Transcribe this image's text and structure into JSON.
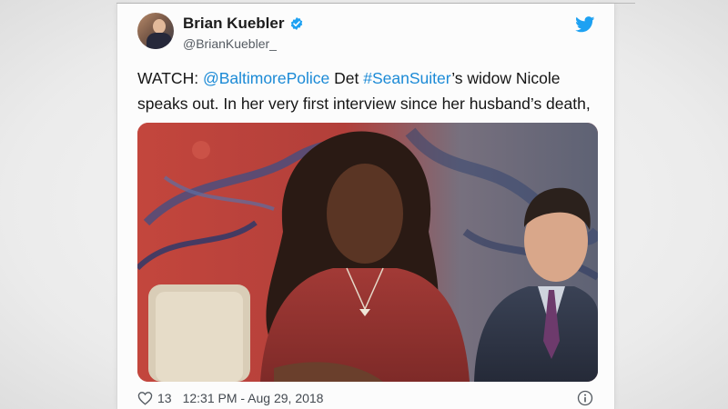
{
  "tweet": {
    "display_name": "Brian Kuebler",
    "handle": "@BrianKuebler_",
    "text": {
      "prefix": "WATCH: ",
      "mention": "@BaltimorePolice",
      "middle": " Det ",
      "hashtag": "#SeanSuiter",
      "suffix": "’s widow Nicole speaks out. In her very first interview since her husband’s death,"
    },
    "likes": "13",
    "timestamp": "12:31 PM - Aug 29, 2018"
  },
  "icons": {
    "verified": "verified-badge-icon",
    "brand": "twitter-bird-icon",
    "like": "heart-icon",
    "info": "info-icon"
  },
  "colors": {
    "link": "#1b8ad6",
    "verified": "#1da1f2",
    "brand": "#1da1f2"
  }
}
